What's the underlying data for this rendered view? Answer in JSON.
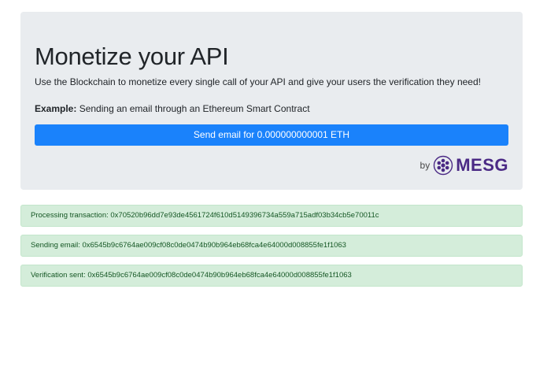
{
  "header": {
    "title": "Monetize your API",
    "lead": "Use the Blockchain to monetize every single call of your API and give your users the verification they need!",
    "example_label": "Example:",
    "example_text": "Sending an email through an Ethereum Smart Contract"
  },
  "action": {
    "send_label": "Send email for 0.000000000001 ETH"
  },
  "brand": {
    "by_text": "by",
    "logo_text": "MESG",
    "logo_icon": "mesg-logo-icon",
    "logo_color": "#4b2a85"
  },
  "alerts": [
    {
      "text": "Processing transaction: 0x70520b96dd7e93de4561724f610d5149396734a559a715adf03b34cb5e70011c"
    },
    {
      "text": "Sending email: 0x6545b9c6764ae009cf08c0de0474b90b964eb68fca4e64000d008855fe1f1063"
    },
    {
      "text": "Verification sent: 0x6545b9c6764ae009cf08c0de0474b90b964eb68fca4e64000d008855fe1f1063"
    }
  ],
  "colors": {
    "jumbotron_bg": "#e9ecef",
    "primary": "#1a82fb",
    "success_bg": "#d4edda",
    "success_text": "#155724"
  }
}
